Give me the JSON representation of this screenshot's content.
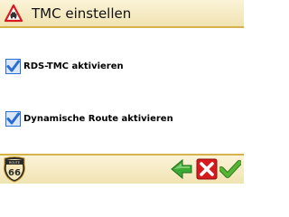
{
  "header": {
    "title": "TMC einstellen",
    "icon": "warning-traffic-icon"
  },
  "options": [
    {
      "label": "RDS-TMC aktivieren",
      "checked": true
    },
    {
      "label": "Dynamische Route aktivieren",
      "checked": true
    }
  ],
  "footer": {
    "logo": {
      "top_text": "ROUTE",
      "number": "66"
    },
    "buttons": [
      {
        "icon": "back-arrow-icon"
      },
      {
        "icon": "cancel-icon"
      },
      {
        "icon": "confirm-icon"
      }
    ]
  },
  "colors": {
    "bar_background": "#f4e8be",
    "bar_border": "#d6b24a",
    "checkbox_blue": "#2b6ed2",
    "back_green": "#3aa935",
    "cancel_red": "#d8191e",
    "confirm_green": "#57b536"
  }
}
